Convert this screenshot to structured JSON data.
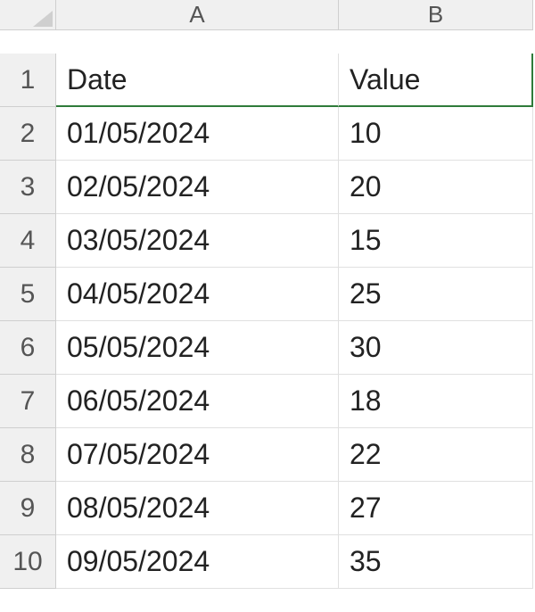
{
  "columns": [
    "A",
    "B"
  ],
  "row_numbers": [
    "1",
    "2",
    "3",
    "4",
    "5",
    "6",
    "7",
    "8",
    "9",
    "10"
  ],
  "headers": {
    "A": "Date",
    "B": "Value"
  },
  "data": [
    {
      "A": "01/05/2024",
      "B": "10"
    },
    {
      "A": "02/05/2024",
      "B": "20"
    },
    {
      "A": "03/05/2024",
      "B": "15"
    },
    {
      "A": "04/05/2024",
      "B": "25"
    },
    {
      "A": "05/05/2024",
      "B": "30"
    },
    {
      "A": "06/05/2024",
      "B": "18"
    },
    {
      "A": "07/05/2024",
      "B": "22"
    },
    {
      "A": "08/05/2024",
      "B": "27"
    },
    {
      "A": "09/05/2024",
      "B": "35"
    }
  ]
}
